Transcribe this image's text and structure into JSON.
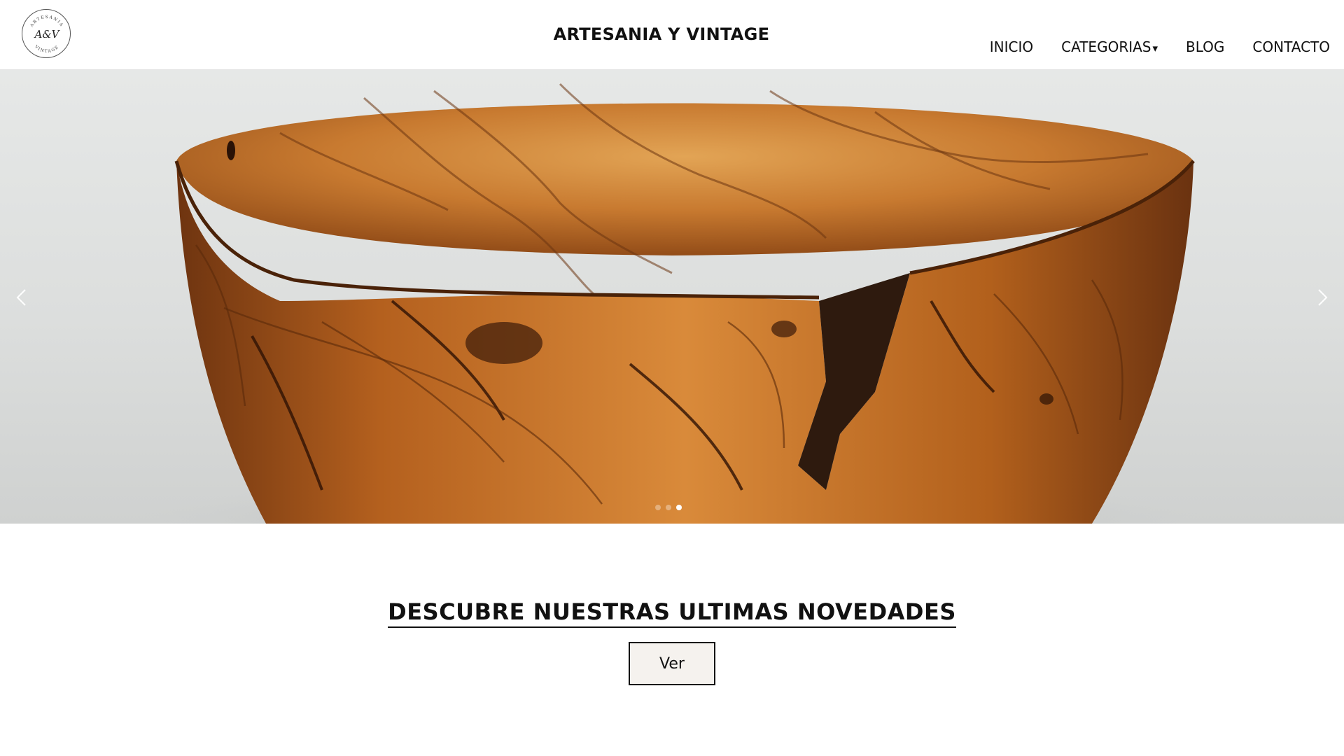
{
  "header": {
    "logo": {
      "initials": "A&V",
      "ring_top": "ARTESANIA",
      "ring_bottom": "VINTAGE"
    },
    "title": "ARTESANIA Y VINTAGE",
    "nav": [
      {
        "label": "INICIO"
      },
      {
        "label": "CATEGORIAS",
        "icon": "caret-down-icon"
      },
      {
        "label": "BLOG"
      },
      {
        "label": "CONTACTO"
      }
    ]
  },
  "hero": {
    "prev_icon": "chevron-left-icon",
    "next_icon": "chevron-right-icon",
    "slides_count": 3,
    "active_slide": 3,
    "image_subject": "olive wood bowl"
  },
  "main": {
    "heading": "DESCUBRE NUESTRAS ULTIMAS NOVEDADES",
    "button_label": "Ver"
  },
  "colors": {
    "background": "#ffffff",
    "text": "#111111",
    "button_bg": "#f5f2ee",
    "wood_dark": "#3a1a08",
    "wood_mid": "#a85418",
    "wood_light": "#d98a3a"
  }
}
